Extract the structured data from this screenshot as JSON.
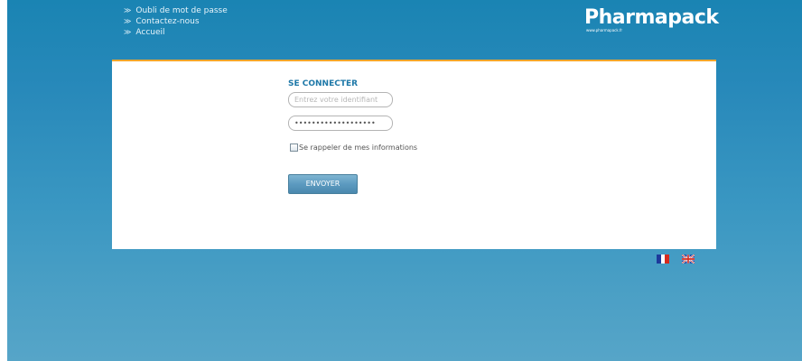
{
  "header": {
    "links": [
      {
        "label": "Oubli de mot de passe"
      },
      {
        "label": "Contactez-nous"
      },
      {
        "label": "Accueil"
      }
    ],
    "link_arrow": "≫",
    "logo": {
      "name": "Pharmapack",
      "url_text": "www.pharmapack.fr"
    }
  },
  "login": {
    "title": "SE CONNECTER",
    "username_placeholder": "Entrez votre identifiant",
    "username_value": "",
    "password_value": "•••••••••••••••••••",
    "remember_label": "Se rappeler de mes informations",
    "remember_checked": false,
    "submit_label": "ENVOYER"
  },
  "languages": [
    {
      "name": "fr-flag-icon",
      "colors": [
        "#1d3a9b",
        "#ffffff",
        "#d52b1e"
      ]
    },
    {
      "name": "uk-flag-icon",
      "colors": [
        "#1d3a9b",
        "#ffffff",
        "#d52b1e"
      ]
    }
  ],
  "colors": {
    "accent_border": "#f2a62b",
    "title_blue": "#1e78a8",
    "button_blue": "#5c9ac0",
    "background_blue": "#2889ba"
  }
}
